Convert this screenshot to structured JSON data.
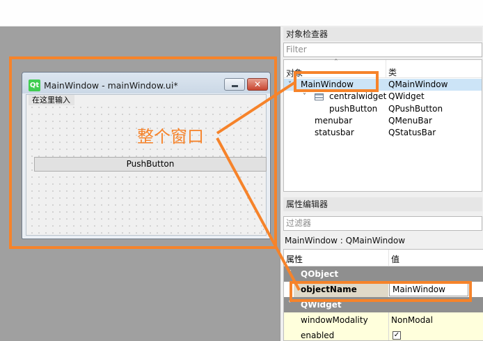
{
  "form_window": {
    "title": "MainWindow - mainWindow.ui*",
    "logo_text": "Qt",
    "menu_placeholder": "在这里输入",
    "push_button_label": "PushButton",
    "minimize_symbol": "▬",
    "close_symbol": "✕"
  },
  "annotation": {
    "text": "整个窗口",
    "color": "#f6832a"
  },
  "object_inspector": {
    "title": "对象检查器",
    "filter_placeholder": "Filter",
    "columns": [
      "对象",
      "类"
    ],
    "rows": [
      {
        "name": "MainWindow",
        "class": "QMainWindow",
        "selected": true,
        "expanded": true
      },
      {
        "name": "centralwidget",
        "class": "QWidget",
        "expanded": true,
        "icon": "widget-icon"
      },
      {
        "name": "pushButton",
        "class": "QPushButton"
      },
      {
        "name": "menubar",
        "class": "QMenuBar"
      },
      {
        "name": "statusbar",
        "class": "QStatusBar"
      }
    ]
  },
  "property_editor": {
    "title": "属性编辑器",
    "filter_placeholder": "过滤器",
    "object_class": "MainWindow : QMainWindow",
    "columns": [
      "属性",
      "值"
    ],
    "groups": [
      {
        "name": "QObject",
        "properties": [
          {
            "key": "objectName",
            "value": "MainWindow"
          }
        ]
      },
      {
        "name": "QWidget",
        "properties": [
          {
            "key": "windowModality",
            "value": "NonModal"
          },
          {
            "key": "enabled",
            "value": "✓"
          }
        ]
      }
    ]
  }
}
